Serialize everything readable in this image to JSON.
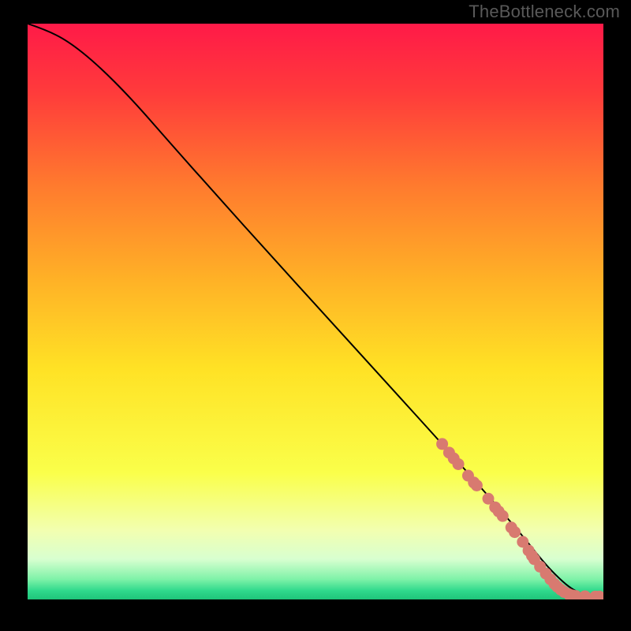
{
  "watermark": "TheBottleneck.com",
  "chart_data": {
    "type": "line",
    "title": "",
    "xlabel": "",
    "ylabel": "",
    "xlim": [
      0,
      100
    ],
    "ylim": [
      0,
      100
    ],
    "grid": false,
    "gradient_stops": [
      {
        "offset": 0.0,
        "color": "#ff1a48"
      },
      {
        "offset": 0.12,
        "color": "#ff3b3b"
      },
      {
        "offset": 0.28,
        "color": "#ff7a2e"
      },
      {
        "offset": 0.45,
        "color": "#ffb326"
      },
      {
        "offset": 0.6,
        "color": "#ffe225"
      },
      {
        "offset": 0.78,
        "color": "#faff4a"
      },
      {
        "offset": 0.88,
        "color": "#f2ffb0"
      },
      {
        "offset": 0.93,
        "color": "#d8ffd0"
      },
      {
        "offset": 0.965,
        "color": "#7ef2a8"
      },
      {
        "offset": 0.985,
        "color": "#2fd98c"
      },
      {
        "offset": 1.0,
        "color": "#1fc47a"
      }
    ],
    "series": [
      {
        "name": "curve",
        "type": "line",
        "color": "#000000",
        "x": [
          0,
          3,
          7,
          12,
          18,
          25,
          33,
          42,
          52,
          62,
          72,
          80,
          86,
          90,
          93,
          95,
          97,
          100
        ],
        "y": [
          100,
          99,
          97,
          93,
          87,
          79,
          70,
          60,
          49,
          38,
          27,
          18,
          11,
          6,
          3,
          1.5,
          0.7,
          0.5
        ]
      },
      {
        "name": "markers",
        "type": "scatter",
        "color": "#d87a70",
        "points": [
          {
            "x": 72.0,
            "y": 27.0
          },
          {
            "x": 73.2,
            "y": 25.5
          },
          {
            "x": 74.0,
            "y": 24.5
          },
          {
            "x": 74.8,
            "y": 23.5
          },
          {
            "x": 76.5,
            "y": 21.5
          },
          {
            "x": 77.5,
            "y": 20.3
          },
          {
            "x": 78.0,
            "y": 19.8
          },
          {
            "x": 80.0,
            "y": 17.5
          },
          {
            "x": 81.2,
            "y": 16.0
          },
          {
            "x": 81.8,
            "y": 15.3
          },
          {
            "x": 82.5,
            "y": 14.5
          },
          {
            "x": 84.0,
            "y": 12.5
          },
          {
            "x": 84.6,
            "y": 11.7
          },
          {
            "x": 86.0,
            "y": 10.0
          },
          {
            "x": 87.0,
            "y": 8.5
          },
          {
            "x": 87.6,
            "y": 7.6
          },
          {
            "x": 88.0,
            "y": 7.0
          },
          {
            "x": 89.0,
            "y": 5.7
          },
          {
            "x": 90.0,
            "y": 4.5
          },
          {
            "x": 90.8,
            "y": 3.5
          },
          {
            "x": 91.5,
            "y": 2.7
          },
          {
            "x": 92.0,
            "y": 2.2
          },
          {
            "x": 92.6,
            "y": 1.7
          },
          {
            "x": 93.2,
            "y": 1.3
          },
          {
            "x": 94.0,
            "y": 0.9
          },
          {
            "x": 94.6,
            "y": 0.7
          },
          {
            "x": 95.2,
            "y": 0.6
          },
          {
            "x": 96.8,
            "y": 0.55
          },
          {
            "x": 98.6,
            "y": 0.5
          },
          {
            "x": 99.3,
            "y": 0.5
          }
        ]
      }
    ]
  }
}
